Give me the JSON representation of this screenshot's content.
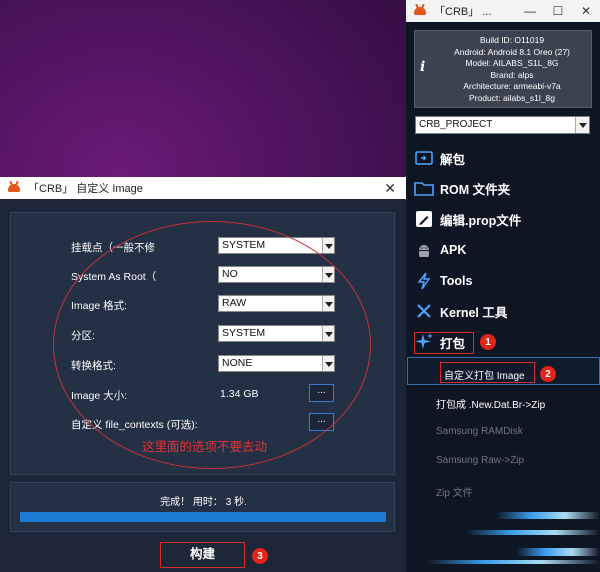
{
  "colors": {
    "accent": "#1a7ad4",
    "annotation": "#d92b2b",
    "panel": "#243044",
    "sidebar": "#0e1624"
  },
  "main_window": {
    "title": "「CRB」 ...",
    "controls": {
      "minimize": "—",
      "maximize": "☐",
      "close": "✕"
    },
    "info": {
      "icon": "i",
      "lines": [
        "Build ID: O11019",
        "Android: Android 8.1 Oreo (27)",
        "Model: AILABS_S1L_8G",
        "Brand: alps",
        "Architecture: armeabi-v7a",
        "Product: ailabs_s1l_8g"
      ]
    },
    "project_select": {
      "value": "CRB_PROJECT"
    },
    "nav": [
      {
        "label": "解包",
        "icon": "unpack-icon"
      },
      {
        "label": "ROM 文件夹",
        "icon": "folder-icon"
      },
      {
        "label": "编辑.prop文件",
        "icon": "edit-file-icon"
      },
      {
        "label": "APK",
        "icon": "android-icon"
      },
      {
        "label": "Tools",
        "icon": "lightning-icon"
      },
      {
        "label": "Kernel 工具",
        "icon": "wrench-icon"
      },
      {
        "label": "打包",
        "icon": "sparkle-icon"
      }
    ],
    "pack_submenu": [
      "自定义打包 Image",
      "打包成 .New.Dat.Br->Zip",
      "Samsung RAMDisk",
      "Samsung Raw->Zip",
      "Zip 文件"
    ],
    "badges": [
      "1",
      "2",
      "3"
    ]
  },
  "dialog": {
    "title": "「CRB」 自定义 Image",
    "close": "✕",
    "options": [
      {
        "label": "挂载点（一般不修",
        "value": "SYSTEM"
      },
      {
        "label": "System As Root（",
        "value": "NO"
      },
      {
        "label": "Image 格式:",
        "value": "RAW"
      },
      {
        "label": "分区:",
        "value": "SYSTEM"
      },
      {
        "label": "转换格式:",
        "value": "NONE"
      }
    ],
    "image_size": {
      "label": "Image 大小:",
      "value": "1.34 GB",
      "button": "..."
    },
    "file_contexts": {
      "label": "自定义 file_contexts (可选):",
      "button": "..."
    },
    "note": "这里面的选项不要去动",
    "progress": {
      "text": "完成！ 用时： 3 秒.",
      "percent": 100
    },
    "build_button": "构建"
  }
}
